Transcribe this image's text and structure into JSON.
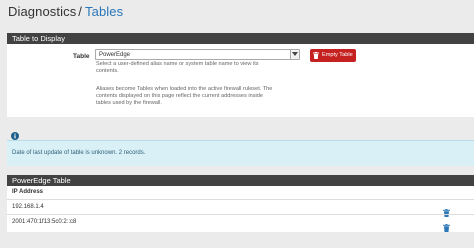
{
  "header": {
    "breadcrumb_parent": "Diagnostics",
    "separator": "/",
    "breadcrumb_current": "Tables"
  },
  "table_panel": {
    "title": "Table to Display",
    "label": "Table",
    "selected_table": "PowerEdge",
    "help_line_1": "Select a user-defined alias name or system table name to view its",
    "help_line_2": "contents.",
    "help_line_3": "Aliases become Tables when loaded into the active firewall ruleset. The",
    "help_line_4": "contents displayed on this page reflect the current addresses inside",
    "help_line_5": "tables used by the firewall.",
    "empty_button": "Empty Table"
  },
  "info": {
    "icon": "info-circle-icon",
    "message": "Date of last update of table is unknown.   2 records."
  },
  "results": {
    "title": "PowerEdge Table",
    "column_header": "IP Address",
    "rows": [
      {
        "ip": "192.168.1.4"
      },
      {
        "ip": "2001:470:1f13:5c0:2::c8"
      }
    ]
  },
  "colors": {
    "panel_heading": "#424242",
    "link_blue": "#2a76b8",
    "danger": "#c62121",
    "alert_bg": "#d9f0f7"
  }
}
